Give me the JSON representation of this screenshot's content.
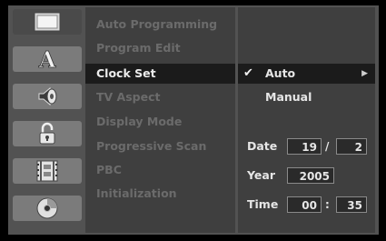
{
  "menu": {
    "items": [
      {
        "label": "Auto Programming"
      },
      {
        "label": "Program Edit"
      },
      {
        "label": "Clock Set"
      },
      {
        "label": "TV Aspect"
      },
      {
        "label": "Display Mode"
      },
      {
        "label": "Progressive Scan"
      },
      {
        "label": "PBC"
      },
      {
        "label": "Initialization"
      }
    ],
    "active_index": 2
  },
  "icons": [
    "tv-screen-icon",
    "letter-a-icon",
    "speaker-icon",
    "padlock-icon",
    "film-icon",
    "disc-icon"
  ],
  "clock_options": {
    "auto_label": "Auto",
    "manual_label": "Manual",
    "check_glyph": "✔",
    "arrow_glyph": "▶"
  },
  "fields": {
    "date_label": "Date",
    "date_day": "19",
    "date_sep": "/",
    "date_month": "2",
    "year_label": "Year",
    "year_value": "2005",
    "time_label": "Time",
    "time_hour": "00",
    "time_sep": ":",
    "time_minute": "35"
  },
  "colors": {
    "highlight": "#1b1b1b",
    "inactive_text": "#6b6b6b",
    "active_text": "#ececec"
  }
}
